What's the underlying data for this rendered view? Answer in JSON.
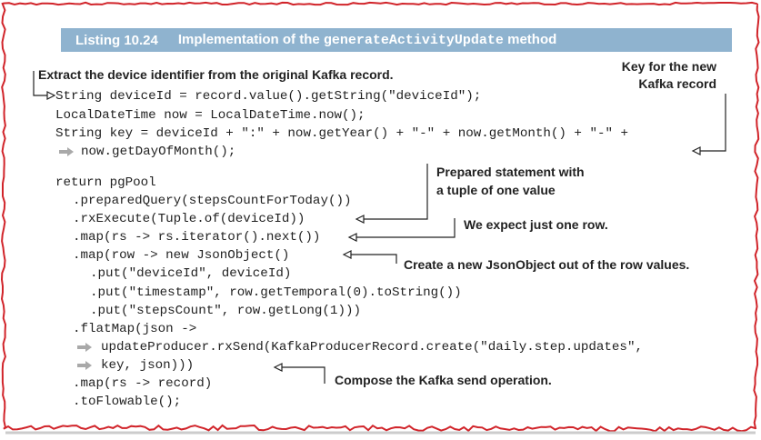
{
  "header": {
    "listing_number": "Listing 10.24",
    "title_prefix": "Implementation of the",
    "title_code": "generateActivityUpdate",
    "title_suffix": "method"
  },
  "code": {
    "l1": "String deviceId = record.value().getString(\"deviceId\");",
    "l2": "LocalDateTime now = LocalDateTime.now();",
    "l3": "String key = deviceId + \":\" + now.getYear() + \"-\" + now.getMonth() + \"-\" +",
    "l4": "now.getDayOfMonth();",
    "l5": "return pgPool",
    "l6": ".preparedQuery(stepsCountForToday())",
    "l7": ".rxExecute(Tuple.of(deviceId))",
    "l8": ".map(rs -> rs.iterator().next())",
    "l9": ".map(row -> new JsonObject()",
    "l10": ".put(\"deviceId\", deviceId)",
    "l11": ".put(\"timestamp\", row.getTemporal(0).toString())",
    "l12": ".put(\"stepsCount\", row.getLong(1)))",
    "l13": ".flatMap(json ->",
    "l14": "updateProducer.rxSend(KafkaProducerRecord.create(\"daily.step.updates\",",
    "l15": "key, json)))",
    "l16": ".map(rs -> record)",
    "l17": ".toFlowable();"
  },
  "annotations": {
    "extract": "Extract the device identifier from the original Kafka record.",
    "key_line1": "Key for the new",
    "key_line2": "Kafka record",
    "prepared_line1": "Prepared statement with",
    "prepared_line2": "a tuple of one value",
    "one_row": "We expect just one row.",
    "json_object": "Create a new JsonObject out of the row values.",
    "compose": "Compose the Kafka send operation."
  },
  "colors": {
    "header_bg": "#8fb3cf",
    "header_text": "#ffffff",
    "frame": "#d1242a",
    "text": "#222222",
    "continuation_arrow": "#a9a9a9"
  },
  "icons": {
    "continuation": "continuation-arrow-icon",
    "callout": "callout-arrow-icon"
  }
}
